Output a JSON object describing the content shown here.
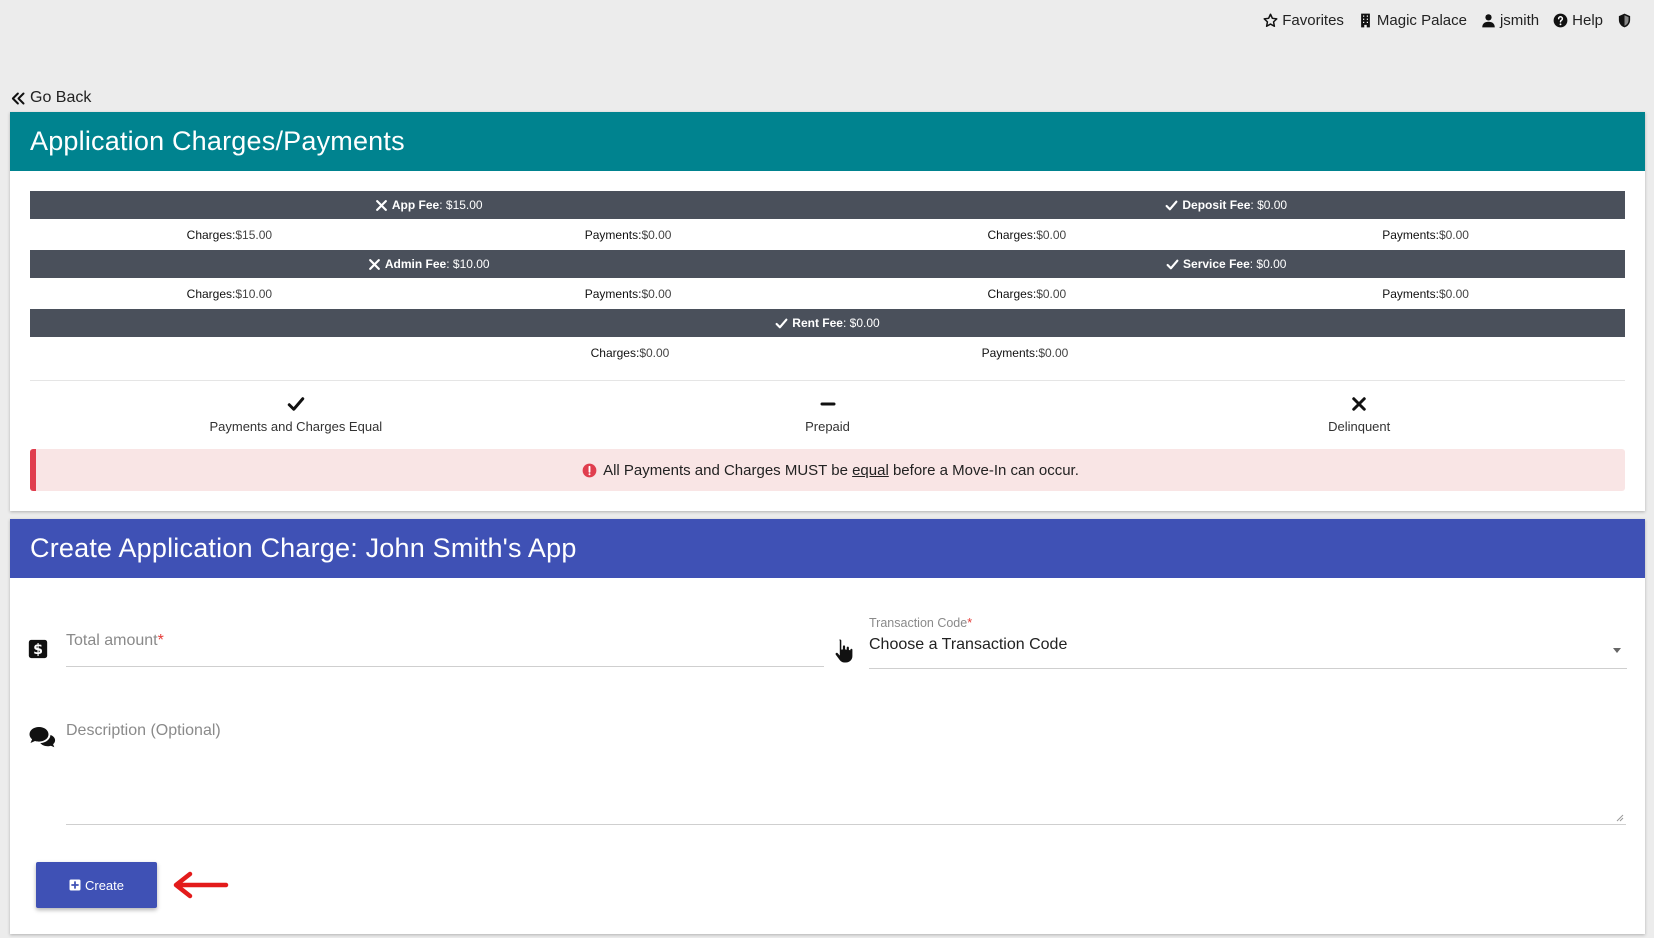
{
  "topnav": {
    "favorites": "Favorites",
    "property": "Magic Palace",
    "user": "jsmith",
    "help": "Help"
  },
  "go_back": "Go Back",
  "charges_card": {
    "title": "Application Charges/Payments",
    "fees": [
      {
        "name": "App Fee",
        "amount": ": $15.00",
        "status": "x",
        "charges_label": "Charges:",
        "charges": "$15.00",
        "payments_label": "Payments:",
        "payments": "$0.00"
      },
      {
        "name": "Deposit Fee",
        "amount": ": $0.00",
        "status": "check",
        "charges_label": "Charges:",
        "charges": "$0.00",
        "payments_label": "Payments:",
        "payments": "$0.00"
      },
      {
        "name": "Admin Fee",
        "amount": ": $10.00",
        "status": "x",
        "charges_label": "Charges:",
        "charges": "$10.00",
        "payments_label": "Payments:",
        "payments": "$0.00"
      },
      {
        "name": "Service Fee",
        "amount": ": $0.00",
        "status": "check",
        "charges_label": "Charges:",
        "charges": "$0.00",
        "payments_label": "Payments:",
        "payments": "$0.00"
      },
      {
        "name": "Rent Fee",
        "amount": ": $0.00",
        "status": "check",
        "charges_label": "Charges:",
        "charges": "$0.00",
        "payments_label": "Payments:",
        "payments": "$0.00"
      }
    ],
    "legend": {
      "equal": "Payments and Charges Equal",
      "prepaid": "Prepaid",
      "delinquent": "Delinquent"
    },
    "alert": {
      "before": "All Payments and Charges MUST be ",
      "emph": "equal",
      "after": " before a Move-In can occur."
    }
  },
  "create_card": {
    "title": "Create Application Charge: John Smith's App",
    "total_amount_label": "Total amount",
    "required_mark": "*",
    "transaction_code_label": "Transaction Code",
    "transaction_code_value": "Choose a Transaction Code",
    "description_label": "Description (Optional)",
    "create_button": "Create"
  },
  "colors": {
    "teal_header": "#00838f",
    "indigo_header": "#3f51b5",
    "fee_bar": "#4a505b",
    "alert_bg": "#f9e5e5",
    "alert_border": "#e03e4e",
    "required": "#e53935"
  }
}
